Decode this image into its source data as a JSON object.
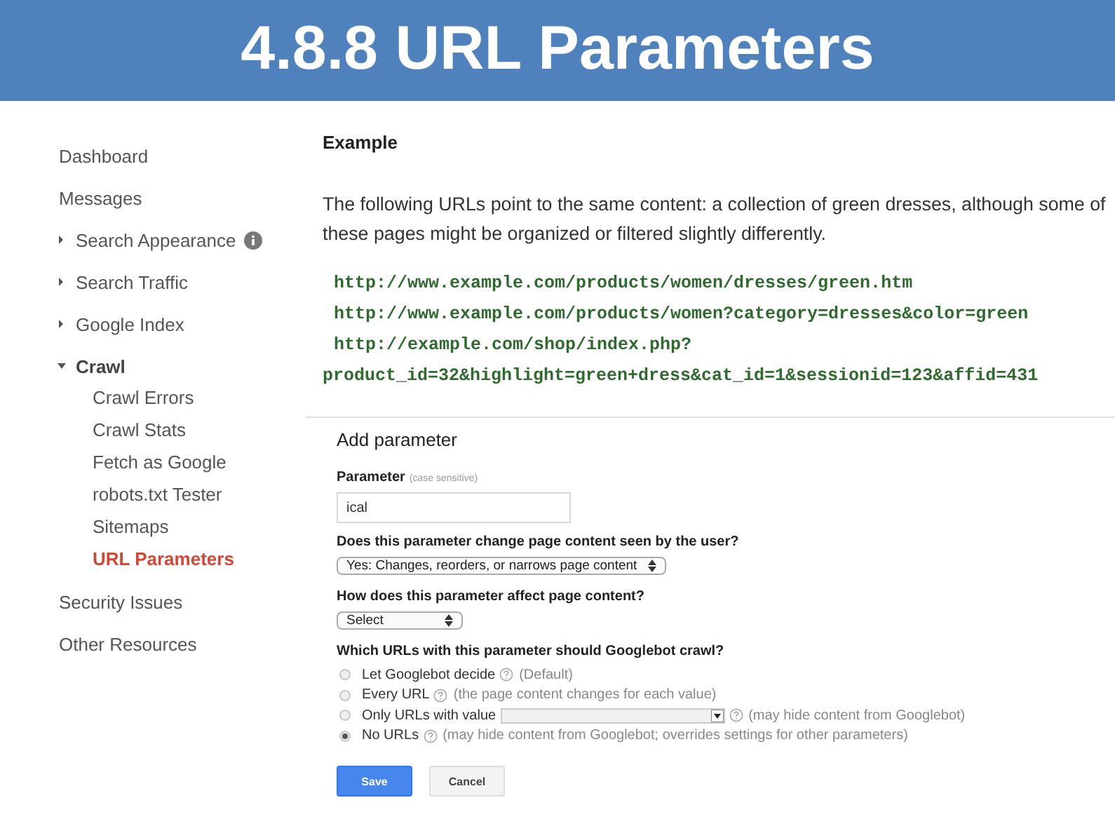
{
  "slide_title": "4.8.8 URL Parameters",
  "sidebar": {
    "items": [
      {
        "label": "Dashboard",
        "kind": "link",
        "info": false
      },
      {
        "label": "Messages",
        "kind": "link",
        "info": false
      },
      {
        "label": "Search Appearance",
        "kind": "group",
        "expanded": false,
        "info": true
      },
      {
        "label": "Search Traffic",
        "kind": "group",
        "expanded": false,
        "info": false
      },
      {
        "label": "Google Index",
        "kind": "group",
        "expanded": false,
        "info": false
      },
      {
        "label": "Crawl",
        "kind": "group",
        "expanded": true,
        "info": false,
        "children": [
          {
            "label": "Crawl Errors",
            "selected": false
          },
          {
            "label": "Crawl Stats",
            "selected": false
          },
          {
            "label": "Fetch as Google",
            "selected": false
          },
          {
            "label": "robots.txt Tester",
            "selected": false
          },
          {
            "label": "Sitemaps",
            "selected": false
          },
          {
            "label": "URL Parameters",
            "selected": true
          }
        ]
      },
      {
        "label": "Security Issues",
        "kind": "link",
        "info": false
      },
      {
        "label": "Other Resources",
        "kind": "link",
        "info": false
      }
    ]
  },
  "example": {
    "heading": "Example",
    "text": "The following URLs point to the same content: a collection of green dresses, although some of these pages might be organized or filtered slightly differently.",
    "urls": [
      "http://www.example.com/products/women/dresses/green.htm",
      "http://www.example.com/products/women?category=dresses&color=green",
      "http://example.com/shop/index.php?"
    ],
    "url_continuation": "product_id=32&highlight=green+dress&cat_id=1&sessionid=123&affid=431"
  },
  "form": {
    "title": "Add parameter",
    "parameter_label": "Parameter",
    "parameter_hint": "(case sensitive)",
    "parameter_value": "ical",
    "question_1": "Does this parameter change page content seen by the user?",
    "answer_1": "Yes: Changes, reorders, or narrows page content",
    "question_2": "How does this parameter affect page content?",
    "answer_2": "Select",
    "question_3": "Which URLs with this parameter should Googlebot crawl?",
    "options": [
      {
        "label": "Let Googlebot decide",
        "note": "(Default)",
        "kind": "plain",
        "selected": false
      },
      {
        "label": "Every URL",
        "note": "(the page content changes for each value)",
        "kind": "plain",
        "selected": false
      },
      {
        "label": "Only URLs with value",
        "note": "(may hide content from Googlebot)",
        "kind": "value",
        "selected": false
      },
      {
        "label": "No URLs",
        "note": "(may hide content from Googlebot; overrides settings for other parameters)",
        "kind": "plain",
        "selected": true
      }
    ],
    "buttons": [
      {
        "label": "Save",
        "kind": "primary"
      },
      {
        "label": "Cancel",
        "kind": "secondary"
      }
    ]
  }
}
